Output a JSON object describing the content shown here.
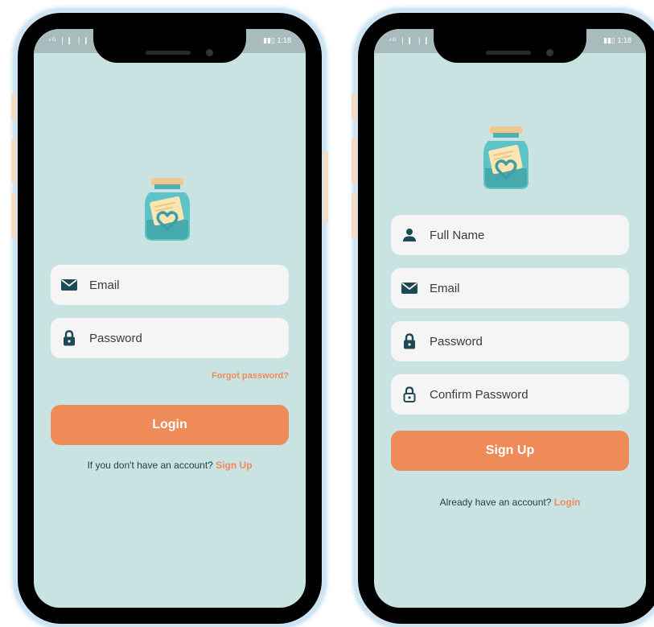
{
  "status_bar": {
    "signal": "⁴ᴳ ❘❙ ❘❙",
    "time": "1:18"
  },
  "login_screen": {
    "email_placeholder": "Email",
    "password_placeholder": "Password",
    "forgot_password": "Forgot password?",
    "login_button": "Login",
    "footer_prompt": "If you don't have an account?",
    "footer_link": "Sign Up"
  },
  "signup_screen": {
    "fullname_placeholder": "Full Name",
    "email_placeholder": "Email",
    "password_placeholder": "Password",
    "confirm_password_placeholder": "Confirm Password",
    "signup_button": "Sign Up",
    "footer_prompt": "Already have an account?",
    "footer_link": "Login"
  },
  "colors": {
    "accent": "#ef8b58",
    "screen_bg": "#c9e3e3",
    "field_bg": "#f5f5f5",
    "icon": "#1c4a55",
    "jar": "#5cc3c6",
    "jar_lid": "#f3c68c"
  }
}
